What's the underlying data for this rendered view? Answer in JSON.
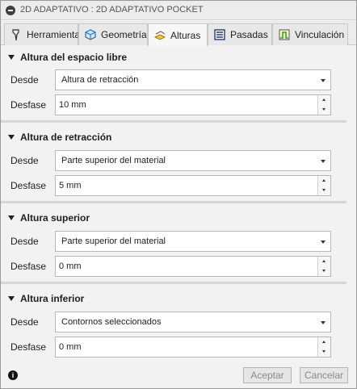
{
  "window": {
    "title": "2D ADAPTATIVO : 2D ADAPTATIVO POCKET"
  },
  "tabs": [
    {
      "label": "Herramienta",
      "icon": "tool-icon",
      "active": false
    },
    {
      "label": "Geometría",
      "icon": "geometry-icon",
      "active": false
    },
    {
      "label": "Alturas",
      "icon": "heights-icon",
      "active": true
    },
    {
      "label": "Pasadas",
      "icon": "passes-icon",
      "active": false
    },
    {
      "label": "Vinculación",
      "icon": "linking-icon",
      "active": false
    }
  ],
  "sections": [
    {
      "title": "Altura del espacio libre",
      "from_label": "Desde",
      "from_value": "Altura de retracción",
      "offset_label": "Desfase",
      "offset_value": "10 mm"
    },
    {
      "title": "Altura de retracción",
      "from_label": "Desde",
      "from_value": "Parte superior del material",
      "offset_label": "Desfase",
      "offset_value": "5 mm"
    },
    {
      "title": "Altura superior",
      "from_label": "Desde",
      "from_value": "Parte superior del material",
      "offset_label": "Desfase",
      "offset_value": "0 mm"
    },
    {
      "title": "Altura inferior",
      "from_label": "Desde",
      "from_value": "Contornos seleccionados",
      "offset_label": "Desfase",
      "offset_value": "0 mm"
    }
  ],
  "footer": {
    "info_icon": "info-icon",
    "accept_label": "Aceptar",
    "cancel_label": "Cancelar"
  },
  "colors": {
    "background": "#f2f2f2",
    "tab_active": "#f7f7f7",
    "border": "#b8b8b8",
    "disabled_text": "#8a8a8a"
  }
}
